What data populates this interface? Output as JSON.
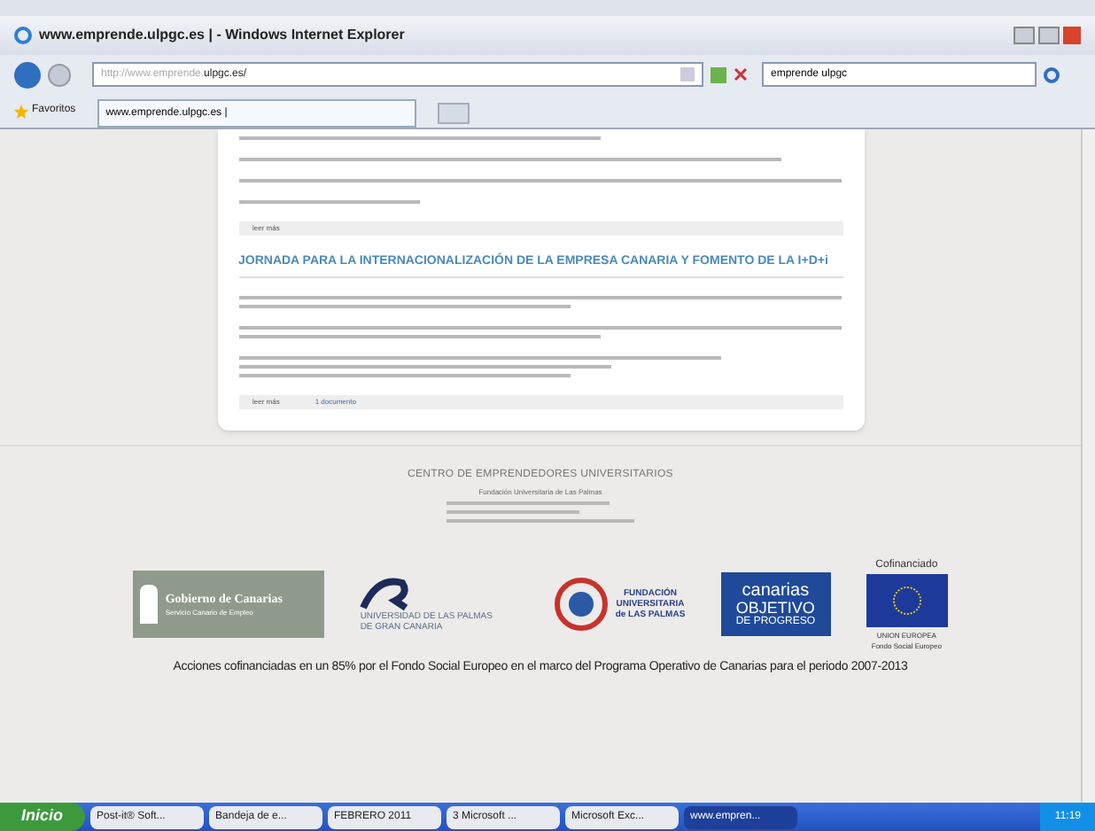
{
  "window": {
    "title": "www.emprende.ulpgc.es | - Windows Internet Explorer"
  },
  "address_bar": {
    "url_prefix": "http://www.emprende.",
    "url_domain": "ulpgc.es/"
  },
  "search": {
    "value": "emprende ulpgc"
  },
  "favorites": {
    "label": "Favoritos"
  },
  "tabs": [
    {
      "label": "www.emprende.ulpgc.es |",
      "selected": true
    }
  ],
  "article_top": {
    "read_more": "leer más"
  },
  "article": {
    "heading": "JORNADA PARA LA INTERNACIONALIZACIÓN DE LA EMPRESA CANARIA Y FOMENTO DE LA I+D+i",
    "read_more": "leer más",
    "documents": "1 documento"
  },
  "footer": {
    "title": "CENTRO DE EMPRENDEDORES UNIVERSITARIOS",
    "lines": [
      "Fundación Universitaria de Las Palmas"
    ]
  },
  "logos": [
    {
      "kind": "gobierno",
      "lines": [
        "Gobierno de Canarias",
        "Servicio Canario de Empleo"
      ]
    },
    {
      "kind": "ulpgc",
      "lines": [
        "UNIVERSIDAD DE LAS PALMAS",
        "DE GRAN CANARIA"
      ]
    },
    {
      "kind": "fundacion",
      "lines": [
        "FUNDACIÓN",
        "UNIVERSITARIA",
        "de LAS PALMAS"
      ]
    },
    {
      "kind": "objetivo",
      "lines": [
        "canarias",
        "OBJETIVO",
        "DE PROGRESO"
      ]
    },
    {
      "kind": "eu",
      "lines": [
        "Cofinanciado",
        "UNION EUROPEA",
        "Fondo Social Europeo"
      ]
    }
  ],
  "funding_note": "Acciones cofinanciadas en un 85% por el Fondo Social Europeo en el marco del Programa Operativo de Canarias para el periodo 2007-2013",
  "taskbar": {
    "start": "Inicio",
    "items": [
      {
        "label": "Post-it® Soft...",
        "selected": false
      },
      {
        "label": "Bandeja de e...",
        "selected": false
      },
      {
        "label": "FEBRERO 2011",
        "selected": false
      },
      {
        "label": "3 Microsoft ...",
        "selected": false
      },
      {
        "label": "Microsoft Exc...",
        "selected": false
      },
      {
        "label": "www.empren...",
        "selected": true
      }
    ],
    "clock": "11:19"
  }
}
